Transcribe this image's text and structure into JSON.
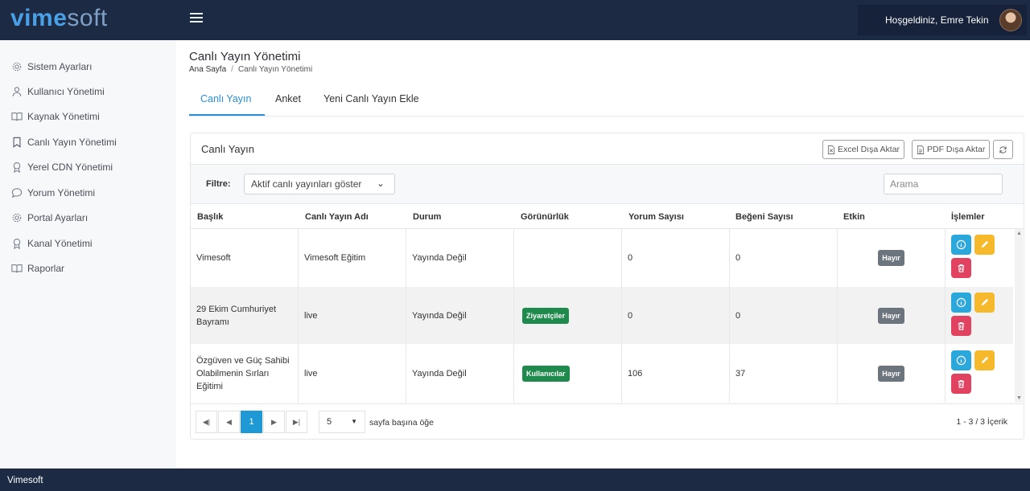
{
  "header": {
    "logo_bold": "vime",
    "logo_light": "soft",
    "welcome": "Hoşgeldiniz, Emre Tekin"
  },
  "sidebar": {
    "items": [
      {
        "label": "Sistem Ayarları",
        "icon": "gear-icon"
      },
      {
        "label": "Kullanıcı Yönetimi",
        "icon": "user-icon"
      },
      {
        "label": "Kaynak Yönetimi",
        "icon": "book-icon"
      },
      {
        "label": "Canlı Yayın Yönetimi",
        "icon": "bookmark-icon"
      },
      {
        "label": "Yerel CDN Yönetimi",
        "icon": "award-icon"
      },
      {
        "label": "Yorum Yönetimi",
        "icon": "comment-icon"
      },
      {
        "label": "Portal Ayarları",
        "icon": "gear-icon"
      },
      {
        "label": "Kanal Yönetimi",
        "icon": "award-icon"
      },
      {
        "label": "Raporlar",
        "icon": "book-icon"
      }
    ]
  },
  "page": {
    "title": "Canlı Yayın Yönetimi",
    "breadcrumb_home": "Ana Sayfa",
    "breadcrumb_sep": "/",
    "breadcrumb_current": "Canlı Yayın Yönetimi"
  },
  "tabs": [
    {
      "label": "Canlı Yayın",
      "active": true
    },
    {
      "label": "Anket",
      "active": false
    },
    {
      "label": "Yeni Canlı Yayın Ekle",
      "active": false
    }
  ],
  "card": {
    "title": "Canlı Yayın",
    "excel_label": "Excel Dışa Aktar",
    "pdf_label": "PDF Dışa Aktar",
    "filter_label": "Filtre:",
    "filter_value": "Aktif canlı yayınları göster",
    "search_placeholder": "Arama"
  },
  "table": {
    "columns": [
      "Başlık",
      "Canlı Yayın Adı",
      "Durum",
      "Görünürlük",
      "Yorum Sayısı",
      "Beğeni Sayısı",
      "Etkin",
      "İşlemler"
    ],
    "rows": [
      {
        "title": "Vimesoft",
        "name": "Vimesoft Eğitim",
        "status": "Yayında Değil",
        "visibility": "",
        "comments": "0",
        "likes": "0",
        "active": "Hayır"
      },
      {
        "title": "29 Ekim Cumhuriyet Bayramı",
        "name": "live",
        "status": "Yayında Değil",
        "visibility": "Ziyaretçiler",
        "comments": "0",
        "likes": "0",
        "active": "Hayır"
      },
      {
        "title": "Özgüven ve Güç Sahibi Olabilmenin Sırları Eğitimi",
        "name": "live",
        "status": "Yayında Değil",
        "visibility": "Kullanıcılar",
        "comments": "106",
        "likes": "37",
        "active": "Hayır"
      }
    ]
  },
  "pager": {
    "current_page": "1",
    "page_size": "5",
    "page_size_label": "sayfa başına öğe",
    "info": "1 - 3 / 3 İçerik"
  },
  "colors": {
    "topbar": "#1c2a44",
    "accent": "#2a8fd6",
    "badge_green": "#1e8a4c",
    "badge_gray": "#6c757d",
    "info": "#2aa8dc",
    "edit": "#f6b92b",
    "delete": "#e0425f"
  },
  "footer": {
    "text": "Vimesoft"
  }
}
